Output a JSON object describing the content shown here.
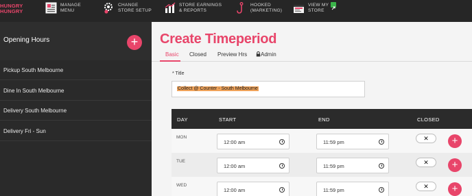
{
  "brand": {
    "line1": "HUNGRY",
    "line2": "HUNGRY",
    "color": "#e8456a"
  },
  "topnav": [
    {
      "id": "manage-menu",
      "line1": "MANAGE",
      "line2": "MENU",
      "icon": "menu-book-icon"
    },
    {
      "id": "change-store-setup",
      "line1": "CHANGE",
      "line2": "STORE SETUP",
      "icon": "gear-icon"
    },
    {
      "id": "store-earnings",
      "line1": "STORE EARNINGS",
      "line2": "& REPORTS",
      "icon": "bar-chart-icon"
    },
    {
      "id": "hooked",
      "line1": "HOOKED",
      "line2": "(MARKETING)",
      "icon": "hook-icon"
    },
    {
      "id": "view-store",
      "line1": "VIEW MY",
      "line2": "STORE",
      "icon": "store-preview-icon"
    }
  ],
  "sidebar": {
    "title": "Opening Hours",
    "add_label": "+",
    "items": [
      {
        "label": "Pickup South Melbourne"
      },
      {
        "label": "Dine In South Melbourne"
      },
      {
        "label": "Delivery South Melbourne"
      },
      {
        "label": "Delivery Fri - Sun"
      }
    ]
  },
  "main": {
    "page_title": "Create Timeperiod",
    "tabs": [
      {
        "label": "Basic",
        "active": true
      },
      {
        "label": "Closed",
        "active": false
      },
      {
        "label": "Preview Hrs",
        "active": false
      },
      {
        "label": "Admin",
        "active": false,
        "icon": "lock-icon"
      }
    ],
    "title_field": {
      "label": "* Title",
      "value": "Collect @ Counter - South Melbourne"
    },
    "table": {
      "headers": {
        "day": "DAY",
        "start": "START",
        "end": "END",
        "closed": "CLOSED"
      },
      "rows": [
        {
          "day": "MON",
          "start": "12:00 am",
          "end": "11:59 pm",
          "closed": "✕",
          "add": "+"
        },
        {
          "day": "TUE",
          "start": "12:00 am",
          "end": "11:59 pm",
          "closed": "✕",
          "add": "+"
        },
        {
          "day": "WED",
          "start": "12:00 am",
          "end": "11:59 pm",
          "closed": "✕",
          "add": "+"
        }
      ]
    }
  }
}
